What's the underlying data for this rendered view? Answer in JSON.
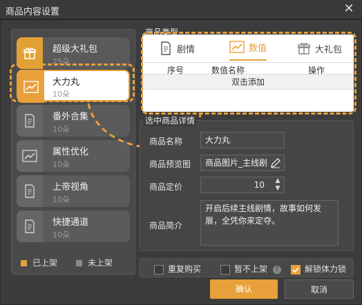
{
  "window": {
    "title": "商品内容设置"
  },
  "items": [
    {
      "name": "超级大礼包",
      "count": "25朵",
      "icon": "gift-icon"
    },
    {
      "name": "大力丸",
      "count": "10朵",
      "icon": "line-chart-icon"
    },
    {
      "name": "番外合集",
      "count": "10朵",
      "icon": "document-icon"
    },
    {
      "name": "属性优化",
      "count": "10朵",
      "icon": "line-chart-icon"
    },
    {
      "name": "上帝视角",
      "count": "10朵",
      "icon": "document-icon"
    },
    {
      "name": "快捷通道",
      "count": "10朵",
      "icon": "document-icon"
    }
  ],
  "legend": {
    "on": "已上架",
    "off": "未上架"
  },
  "type": {
    "group_title": "商品类型",
    "tabs": [
      "剧情",
      "数值",
      "大礼包"
    ],
    "columns": [
      "序号",
      "数值名称",
      "操作"
    ],
    "add_hint": "双击添加"
  },
  "detail": {
    "group_title": "选中商品详情",
    "name_label": "商品名称",
    "name_value": "大力丸",
    "preview_label": "商品预览图",
    "preview_value": "商品图片_主线剧",
    "price_label": "商品定价",
    "price_value": "10",
    "desc_label": "商品简介",
    "desc_value": "开启后续主线剧情，故事如何发展，全凭你来定夺。"
  },
  "options": {
    "repeat": "重复购买",
    "pause": "暂不上架",
    "unlock": "解锁体力锁"
  },
  "buttons": {
    "ok": "确认",
    "cancel": "取消"
  },
  "colors": {
    "accent": "#e8a03a",
    "window": "#3c3c3c"
  }
}
